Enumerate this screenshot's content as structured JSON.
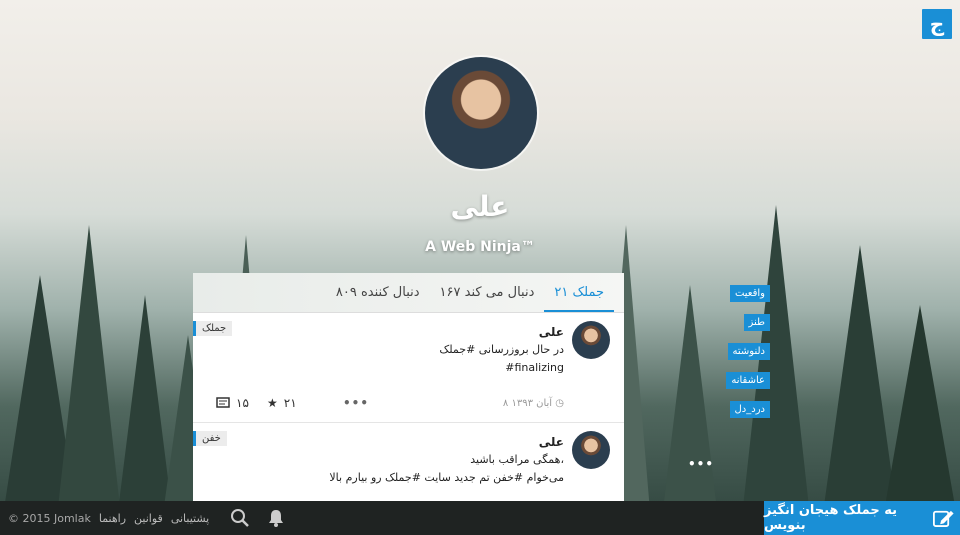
{
  "brand": {
    "logo_text": "ج"
  },
  "profile": {
    "name": "علی",
    "tagline": "A Web Ninja™"
  },
  "tabs": [
    {
      "label": "۲۱ جملک",
      "active": true
    },
    {
      "label": "۱۶۷ دنبال می کند",
      "active": false
    },
    {
      "label": "۸۰۹ دنبال کننده",
      "active": false
    }
  ],
  "posts": [
    {
      "tag": "جملک",
      "author": "علی",
      "lines": [
        "در حال بروزرسانی #جملک",
        "#finalizing"
      ],
      "time": "۸ آبان ۱۳۹۳",
      "stars": "۲۱",
      "comments": "۱۵"
    },
    {
      "tag": "خفن",
      "author": "علی",
      "lines": [
        "همگی مراقب باشید،",
        "می‌خوام #خفن تم جدید سایت #جملک رو بیارم بالا"
      ]
    }
  ],
  "hashtags": [
    "واقعیت",
    "طنز",
    "دلنوشته",
    "عاشقانه",
    "درد_دل"
  ],
  "footer": {
    "write_label": "یه جملک هیجان انگیز بنویس",
    "copyright": "© 2015 Jomlak",
    "links": [
      "راهنما",
      "قوانین",
      "پشتیبانی"
    ]
  },
  "colors": {
    "accent": "#1a8fd6",
    "footer_bg": "#1f2322"
  },
  "icons": {
    "write": "edit-icon",
    "search": "search-icon",
    "notifications": "bell-icon",
    "star": "star-icon",
    "comment": "comment-icon",
    "clock": "clock-icon",
    "more": "more-icon"
  }
}
